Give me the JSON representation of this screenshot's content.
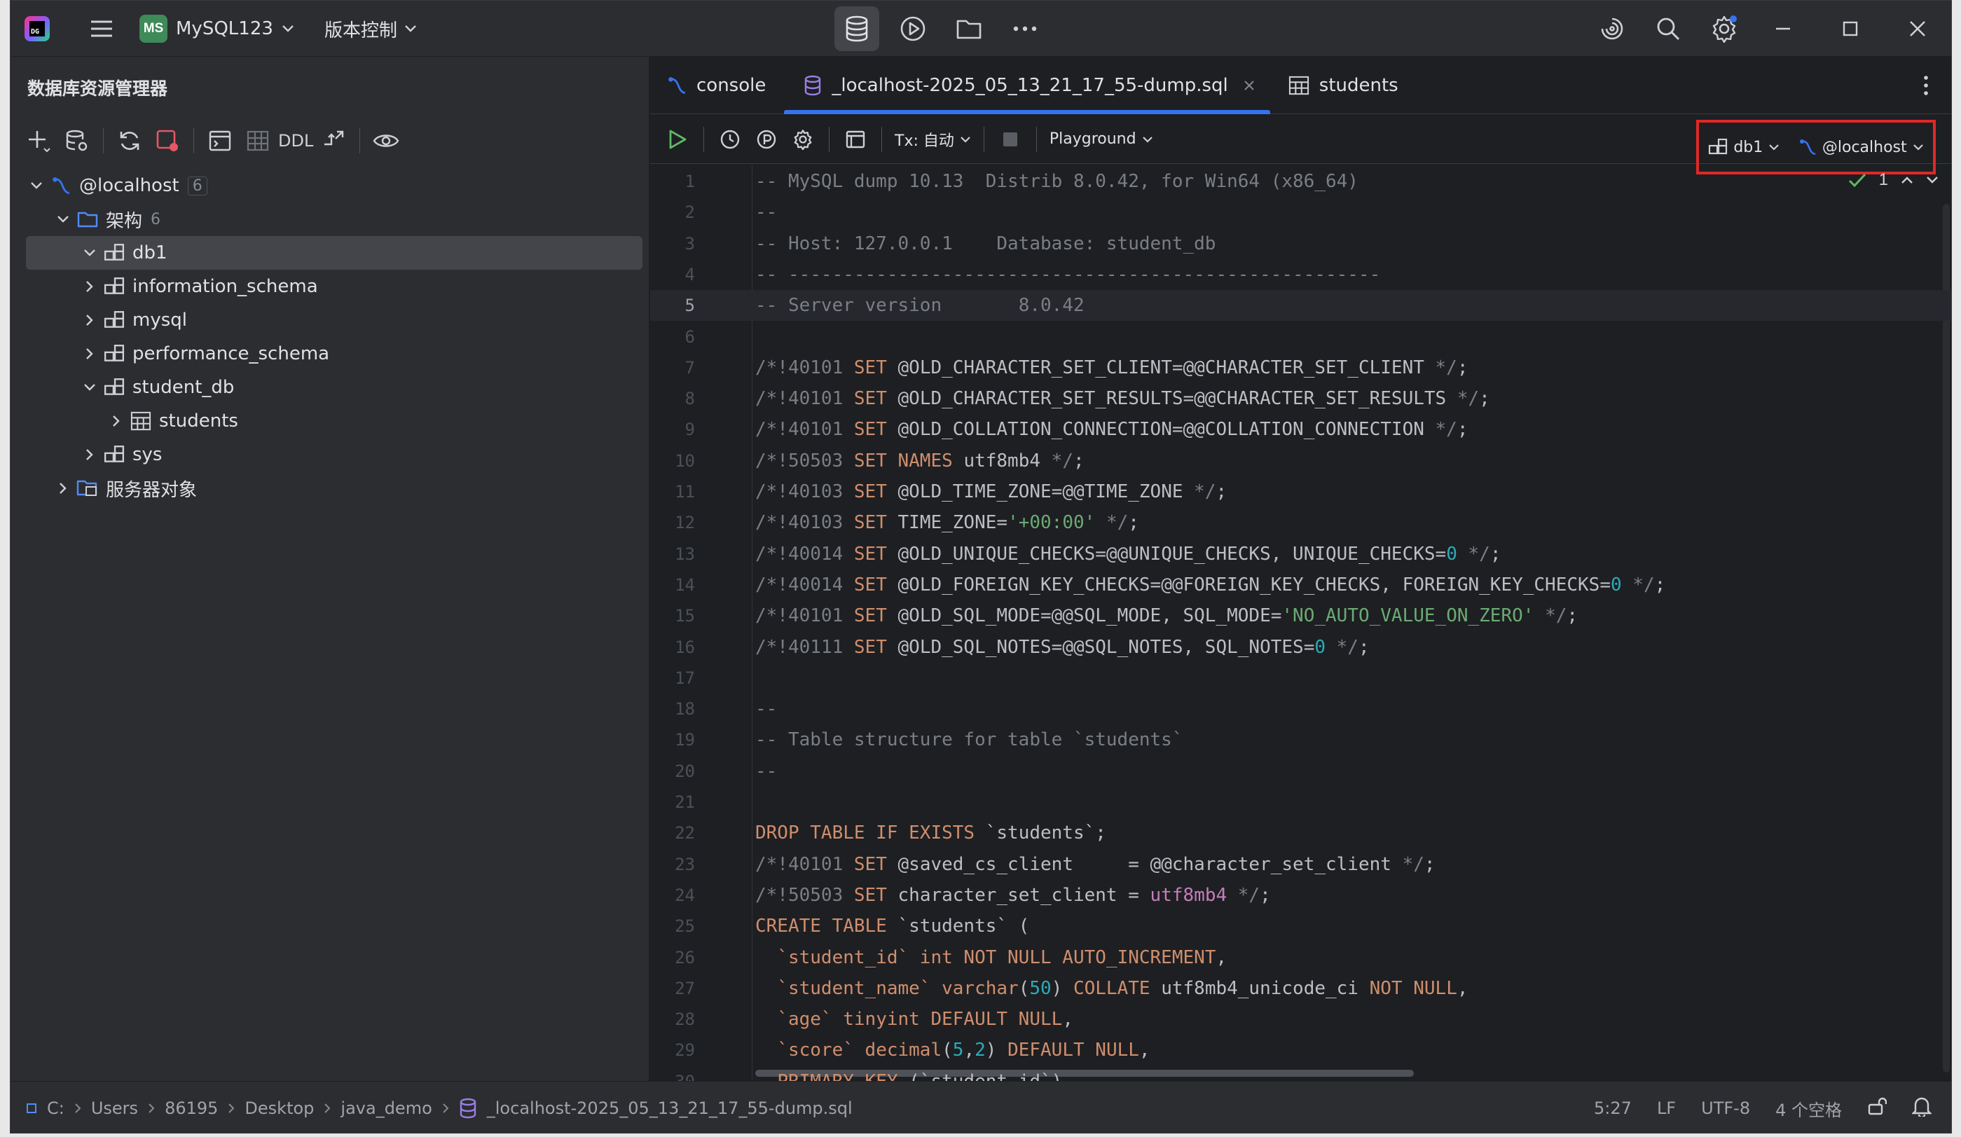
{
  "titlebar": {
    "project_badge": "MS",
    "project_name": "MySQL123",
    "vcs_label": "版本控制"
  },
  "left_panel": {
    "title": "数据库资源管理器",
    "toolbar": {
      "ddl_label": "DDL"
    },
    "tree": [
      {
        "label": "@localhost",
        "count": "6",
        "level": 0,
        "expanded": true,
        "icon": "datasource-icon",
        "boxed_count": true
      },
      {
        "label": "架构",
        "count": "6",
        "level": 1,
        "expanded": true,
        "icon": "folder-icon"
      },
      {
        "label": "db1",
        "count": "",
        "level": 2,
        "expanded": true,
        "icon": "schema-icon",
        "selected": true
      },
      {
        "label": "information_schema",
        "count": "",
        "level": 2,
        "expanded": false,
        "icon": "schema-icon"
      },
      {
        "label": "mysql",
        "count": "",
        "level": 2,
        "expanded": false,
        "icon": "schema-icon"
      },
      {
        "label": "performance_schema",
        "count": "",
        "level": 2,
        "expanded": false,
        "icon": "schema-icon"
      },
      {
        "label": "student_db",
        "count": "",
        "level": 2,
        "expanded": true,
        "icon": "schema-icon"
      },
      {
        "label": "students",
        "count": "",
        "level": 3,
        "expanded": false,
        "icon": "table-icon"
      },
      {
        "label": "sys",
        "count": "",
        "level": 2,
        "expanded": false,
        "icon": "schema-icon"
      },
      {
        "label": "服务器对象",
        "count": "",
        "level": 1,
        "expanded": false,
        "icon": "server-objects-icon"
      }
    ]
  },
  "tabs": [
    {
      "label": "console",
      "icon": "console-icon",
      "active": false
    },
    {
      "label": "_localhost-2025_05_13_21_17_55-dump.sql",
      "icon": "sql-file-icon",
      "active": true,
      "closable": true
    },
    {
      "label": "students",
      "icon": "table-icon",
      "active": false
    }
  ],
  "editor_toolbar": {
    "tx_label": "Tx: 自动",
    "playground_label": "Playground",
    "schema_label": "db1",
    "datasource_label": "@localhost"
  },
  "inspection": {
    "count": "1"
  },
  "code": {
    "current_line": 5,
    "lines": [
      [
        [
          "c",
          "-- MySQL dump 10.13  Distrib 8.0.42, for Win64 (x86_64)"
        ]
      ],
      [
        [
          "c",
          "--"
        ]
      ],
      [
        [
          "c",
          "-- Host: 127.0.0.1    Database: student_db"
        ]
      ],
      [
        [
          "c",
          "-- ------------------------------------------------------"
        ]
      ],
      [
        [
          "c",
          "-- Server version\t8.0.42"
        ]
      ],
      [],
      [
        [
          "c",
          "/*!40101 "
        ],
        [
          "k",
          "SET "
        ],
        [
          "p",
          "@OLD_CHARACTER_SET_CLIENT=@@CHARACTER_SET_CLIENT "
        ],
        [
          "c",
          "*/"
        ],
        [
          "p",
          ";"
        ]
      ],
      [
        [
          "c",
          "/*!40101 "
        ],
        [
          "k",
          "SET "
        ],
        [
          "p",
          "@OLD_CHARACTER_SET_RESULTS=@@CHARACTER_SET_RESULTS "
        ],
        [
          "c",
          "*/"
        ],
        [
          "p",
          ";"
        ]
      ],
      [
        [
          "c",
          "/*!40101 "
        ],
        [
          "k",
          "SET "
        ],
        [
          "p",
          "@OLD_COLLATION_CONNECTION=@@COLLATION_CONNECTION "
        ],
        [
          "c",
          "*/"
        ],
        [
          "p",
          ";"
        ]
      ],
      [
        [
          "c",
          "/*!50503 "
        ],
        [
          "k",
          "SET NAMES "
        ],
        [
          "p",
          "utf8mb4 "
        ],
        [
          "c",
          "*/"
        ],
        [
          "p",
          ";"
        ]
      ],
      [
        [
          "c",
          "/*!40103 "
        ],
        [
          "k",
          "SET "
        ],
        [
          "p",
          "@OLD_TIME_ZONE=@@TIME_ZONE "
        ],
        [
          "c",
          "*/"
        ],
        [
          "p",
          ";"
        ]
      ],
      [
        [
          "c",
          "/*!40103 "
        ],
        [
          "k",
          "SET "
        ],
        [
          "p",
          "TIME_ZONE="
        ],
        [
          "s",
          "'+00:00'"
        ],
        [
          "p",
          " "
        ],
        [
          "c",
          "*/"
        ],
        [
          "p",
          ";"
        ]
      ],
      [
        [
          "c",
          "/*!40014 "
        ],
        [
          "k",
          "SET "
        ],
        [
          "p",
          "@OLD_UNIQUE_CHECKS=@@UNIQUE_CHECKS, UNIQUE_CHECKS="
        ],
        [
          "n",
          "0"
        ],
        [
          "p",
          " "
        ],
        [
          "c",
          "*/"
        ],
        [
          "p",
          ";"
        ]
      ],
      [
        [
          "c",
          "/*!40014 "
        ],
        [
          "k",
          "SET "
        ],
        [
          "p",
          "@OLD_FOREIGN_KEY_CHECKS=@@FOREIGN_KEY_CHECKS, FOREIGN_KEY_CHECKS="
        ],
        [
          "n",
          "0"
        ],
        [
          "p",
          " "
        ],
        [
          "c",
          "*/"
        ],
        [
          "p",
          ";"
        ]
      ],
      [
        [
          "c",
          "/*!40101 "
        ],
        [
          "k",
          "SET "
        ],
        [
          "p",
          "@OLD_SQL_MODE=@@SQL_MODE, SQL_MODE="
        ],
        [
          "s",
          "'NO_AUTO_VALUE_ON_ZERO'"
        ],
        [
          "p",
          " "
        ],
        [
          "c",
          "*/"
        ],
        [
          "p",
          ";"
        ]
      ],
      [
        [
          "c",
          "/*!40111 "
        ],
        [
          "k",
          "SET "
        ],
        [
          "p",
          "@OLD_SQL_NOTES=@@SQL_NOTES, SQL_NOTES="
        ],
        [
          "n",
          "0"
        ],
        [
          "p",
          " "
        ],
        [
          "c",
          "*/"
        ],
        [
          "p",
          ";"
        ]
      ],
      [],
      [
        [
          "c",
          "--"
        ]
      ],
      [
        [
          "c",
          "-- Table structure for table `students`"
        ]
      ],
      [
        [
          "c",
          "--"
        ]
      ],
      [],
      [
        [
          "k",
          "DROP TABLE IF EXISTS "
        ],
        [
          "p",
          "`students`;"
        ]
      ],
      [
        [
          "c",
          "/*!40101 "
        ],
        [
          "k",
          "SET "
        ],
        [
          "p",
          "@saved_cs_client     = @@character_set_client "
        ],
        [
          "c",
          "*/"
        ],
        [
          "p",
          ";"
        ]
      ],
      [
        [
          "c",
          "/*!50503 "
        ],
        [
          "k",
          "SET "
        ],
        [
          "p",
          "character_set_client = "
        ],
        [
          "b",
          "utf8mb4"
        ],
        [
          "p",
          " "
        ],
        [
          "c",
          "*/"
        ],
        [
          "p",
          ";"
        ]
      ],
      [
        [
          "k",
          "CREATE TABLE "
        ],
        [
          "p",
          "`students` ("
        ]
      ],
      [
        [
          "p",
          "  "
        ],
        [
          "k",
          "`student_id` int NOT NULL AUTO_INCREMENT"
        ],
        [
          "p",
          ","
        ]
      ],
      [
        [
          "p",
          "  "
        ],
        [
          "k",
          "`student_name` varchar"
        ],
        [
          "p",
          "("
        ],
        [
          "n",
          "50"
        ],
        [
          "p",
          ") "
        ],
        [
          "k",
          "COLLATE "
        ],
        [
          "p",
          "utf8mb4_unicode_ci "
        ],
        [
          "k",
          "NOT NULL"
        ],
        [
          "p",
          ","
        ]
      ],
      [
        [
          "p",
          "  "
        ],
        [
          "k",
          "`age` tinyint DEFAULT NULL"
        ],
        [
          "p",
          ","
        ]
      ],
      [
        [
          "p",
          "  "
        ],
        [
          "k",
          "`score` decimal"
        ],
        [
          "p",
          "("
        ],
        [
          "n",
          "5"
        ],
        [
          "p",
          ","
        ],
        [
          "n",
          "2"
        ],
        [
          "p",
          ") "
        ],
        [
          "k",
          "DEFAULT NULL"
        ],
        [
          "p",
          ","
        ]
      ],
      [
        [
          "p",
          "  "
        ],
        [
          "k",
          "PRIMARY KEY "
        ],
        [
          "p",
          "(`student_id`)"
        ]
      ]
    ]
  },
  "statusbar": {
    "breadcrumbs": [
      "C:",
      "Users",
      "86195",
      "Desktop",
      "java_demo",
      "_localhost-2025_05_13_21_17_55-dump.sql"
    ],
    "position": "5:27",
    "line_ending": "LF",
    "encoding": "UTF-8",
    "indent": "4 个空格"
  }
}
